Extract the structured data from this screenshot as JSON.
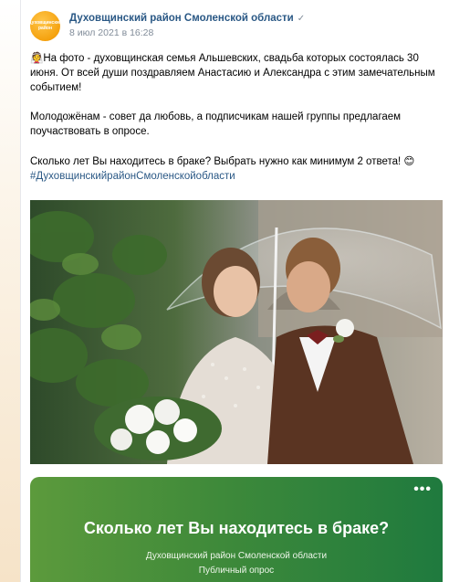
{
  "post": {
    "group_name": "Духовщинский район Смоленской области",
    "date": "8 июл 2021 в 16:28",
    "avatar_text": "Духовщинский район",
    "text": {
      "line1_emoji": "👰",
      "line1": "На фото - духовщинская семья Альшевских, свадьба которых состоялась 30 июня. От всей души поздравляем Анастасию и Александра с этим замечательным событием!",
      "line2": "Молодожёнам - совет да любовь, а подписчикам нашей группы предлагаем поучаствовать в опросе.",
      "line3": "Сколько лет Вы находитесь в браке? Выбрать нужно как минимум 2 ответа!",
      "line3_emoji": "😊",
      "hashtag": "#ДуховщинскийрайонСмоленскойобласти"
    }
  },
  "poll": {
    "more_label": "•••",
    "question": "Сколько лет Вы находитесь в браке?",
    "owner": "Духовщинский район Смоленской области",
    "type": "Публичный опрос"
  },
  "colors": {
    "link": "#2a5885",
    "meta": "#818c99",
    "poll_gradient_start": "#5c9a3c",
    "poll_gradient_end": "#1f7a3e"
  }
}
